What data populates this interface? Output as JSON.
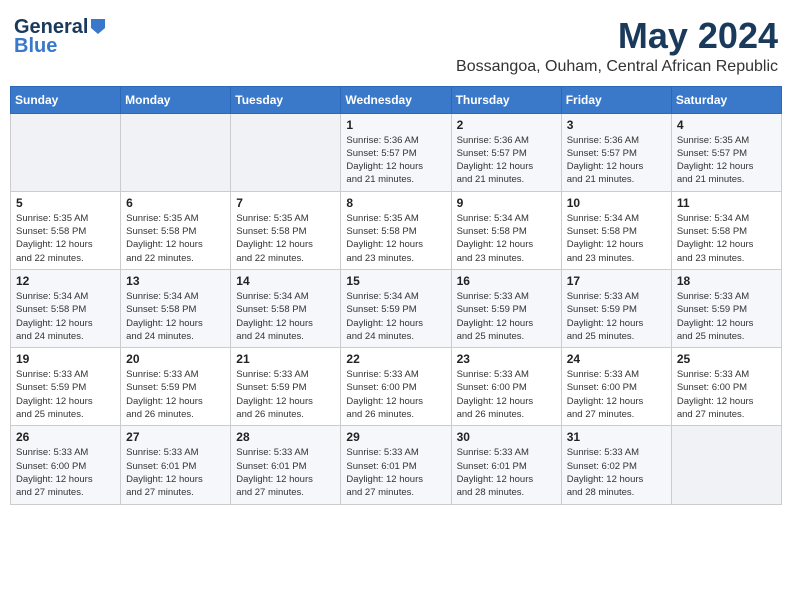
{
  "logo": {
    "line1": "General",
    "line2": "Blue"
  },
  "title": "May 2024",
  "location": "Bossangoa, Ouham, Central African Republic",
  "weekdays": [
    "Sunday",
    "Monday",
    "Tuesday",
    "Wednesday",
    "Thursday",
    "Friday",
    "Saturday"
  ],
  "weeks": [
    [
      {
        "day": "",
        "info": ""
      },
      {
        "day": "",
        "info": ""
      },
      {
        "day": "",
        "info": ""
      },
      {
        "day": "1",
        "info": "Sunrise: 5:36 AM\nSunset: 5:57 PM\nDaylight: 12 hours\nand 21 minutes."
      },
      {
        "day": "2",
        "info": "Sunrise: 5:36 AM\nSunset: 5:57 PM\nDaylight: 12 hours\nand 21 minutes."
      },
      {
        "day": "3",
        "info": "Sunrise: 5:36 AM\nSunset: 5:57 PM\nDaylight: 12 hours\nand 21 minutes."
      },
      {
        "day": "4",
        "info": "Sunrise: 5:35 AM\nSunset: 5:57 PM\nDaylight: 12 hours\nand 21 minutes."
      }
    ],
    [
      {
        "day": "5",
        "info": "Sunrise: 5:35 AM\nSunset: 5:58 PM\nDaylight: 12 hours\nand 22 minutes."
      },
      {
        "day": "6",
        "info": "Sunrise: 5:35 AM\nSunset: 5:58 PM\nDaylight: 12 hours\nand 22 minutes."
      },
      {
        "day": "7",
        "info": "Sunrise: 5:35 AM\nSunset: 5:58 PM\nDaylight: 12 hours\nand 22 minutes."
      },
      {
        "day": "8",
        "info": "Sunrise: 5:35 AM\nSunset: 5:58 PM\nDaylight: 12 hours\nand 23 minutes."
      },
      {
        "day": "9",
        "info": "Sunrise: 5:34 AM\nSunset: 5:58 PM\nDaylight: 12 hours\nand 23 minutes."
      },
      {
        "day": "10",
        "info": "Sunrise: 5:34 AM\nSunset: 5:58 PM\nDaylight: 12 hours\nand 23 minutes."
      },
      {
        "day": "11",
        "info": "Sunrise: 5:34 AM\nSunset: 5:58 PM\nDaylight: 12 hours\nand 23 minutes."
      }
    ],
    [
      {
        "day": "12",
        "info": "Sunrise: 5:34 AM\nSunset: 5:58 PM\nDaylight: 12 hours\nand 24 minutes."
      },
      {
        "day": "13",
        "info": "Sunrise: 5:34 AM\nSunset: 5:58 PM\nDaylight: 12 hours\nand 24 minutes."
      },
      {
        "day": "14",
        "info": "Sunrise: 5:34 AM\nSunset: 5:58 PM\nDaylight: 12 hours\nand 24 minutes."
      },
      {
        "day": "15",
        "info": "Sunrise: 5:34 AM\nSunset: 5:59 PM\nDaylight: 12 hours\nand 24 minutes."
      },
      {
        "day": "16",
        "info": "Sunrise: 5:33 AM\nSunset: 5:59 PM\nDaylight: 12 hours\nand 25 minutes."
      },
      {
        "day": "17",
        "info": "Sunrise: 5:33 AM\nSunset: 5:59 PM\nDaylight: 12 hours\nand 25 minutes."
      },
      {
        "day": "18",
        "info": "Sunrise: 5:33 AM\nSunset: 5:59 PM\nDaylight: 12 hours\nand 25 minutes."
      }
    ],
    [
      {
        "day": "19",
        "info": "Sunrise: 5:33 AM\nSunset: 5:59 PM\nDaylight: 12 hours\nand 25 minutes."
      },
      {
        "day": "20",
        "info": "Sunrise: 5:33 AM\nSunset: 5:59 PM\nDaylight: 12 hours\nand 26 minutes."
      },
      {
        "day": "21",
        "info": "Sunrise: 5:33 AM\nSunset: 5:59 PM\nDaylight: 12 hours\nand 26 minutes."
      },
      {
        "day": "22",
        "info": "Sunrise: 5:33 AM\nSunset: 6:00 PM\nDaylight: 12 hours\nand 26 minutes."
      },
      {
        "day": "23",
        "info": "Sunrise: 5:33 AM\nSunset: 6:00 PM\nDaylight: 12 hours\nand 26 minutes."
      },
      {
        "day": "24",
        "info": "Sunrise: 5:33 AM\nSunset: 6:00 PM\nDaylight: 12 hours\nand 27 minutes."
      },
      {
        "day": "25",
        "info": "Sunrise: 5:33 AM\nSunset: 6:00 PM\nDaylight: 12 hours\nand 27 minutes."
      }
    ],
    [
      {
        "day": "26",
        "info": "Sunrise: 5:33 AM\nSunset: 6:00 PM\nDaylight: 12 hours\nand 27 minutes."
      },
      {
        "day": "27",
        "info": "Sunrise: 5:33 AM\nSunset: 6:01 PM\nDaylight: 12 hours\nand 27 minutes."
      },
      {
        "day": "28",
        "info": "Sunrise: 5:33 AM\nSunset: 6:01 PM\nDaylight: 12 hours\nand 27 minutes."
      },
      {
        "day": "29",
        "info": "Sunrise: 5:33 AM\nSunset: 6:01 PM\nDaylight: 12 hours\nand 27 minutes."
      },
      {
        "day": "30",
        "info": "Sunrise: 5:33 AM\nSunset: 6:01 PM\nDaylight: 12 hours\nand 28 minutes."
      },
      {
        "day": "31",
        "info": "Sunrise: 5:33 AM\nSunset: 6:02 PM\nDaylight: 12 hours\nand 28 minutes."
      },
      {
        "day": "",
        "info": ""
      }
    ]
  ]
}
